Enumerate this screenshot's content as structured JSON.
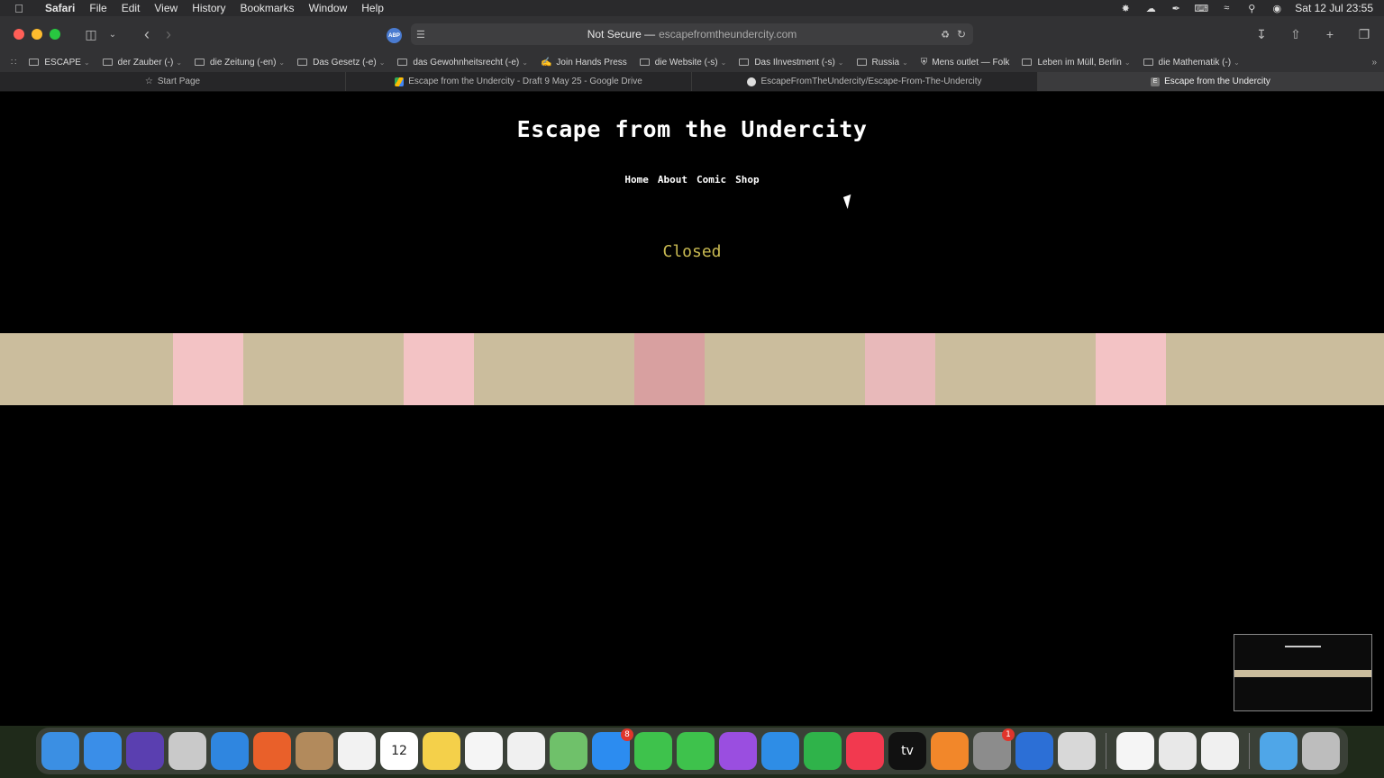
{
  "menubar": {
    "app_name": "Safari",
    "items": [
      "File",
      "Edit",
      "View",
      "History",
      "Bookmarks",
      "Window",
      "Help"
    ],
    "clock": "Sat 12 Jul  23:55",
    "status_icons": [
      "chatgpt-icon",
      "cloud-icon",
      "pen-icon",
      "keyboard-icon",
      "wifi-icon",
      "spotlight-icon",
      "control-center-icon"
    ]
  },
  "toolbar": {
    "security_label": "Not Secure —",
    "url": "escapefromtheundercity.com",
    "extension_badge": "ABP"
  },
  "bookmarks": [
    {
      "label": "ESCAPE",
      "type": "folder"
    },
    {
      "label": "der Zauber (-)",
      "type": "folder"
    },
    {
      "label": "die Zeitung (-en)",
      "type": "folder"
    },
    {
      "label": "Das Gesetz (-e)",
      "type": "folder"
    },
    {
      "label": "das Gewohnheitsrecht (-e)",
      "type": "folder"
    },
    {
      "label": "Join Hands Press",
      "type": "link"
    },
    {
      "label": "die Website (-s)",
      "type": "folder"
    },
    {
      "label": "Das Ilnvestment (-s)",
      "type": "folder"
    },
    {
      "label": "Russia",
      "type": "folder"
    },
    {
      "label": "Mens outlet — Folk",
      "type": "link"
    },
    {
      "label": "Leben im Müll, Berlin",
      "type": "folder"
    },
    {
      "label": "die Mathematik (-)",
      "type": "folder"
    }
  ],
  "tabs": [
    {
      "label": "Start Page",
      "active": false
    },
    {
      "label": "Escape from the Undercity - Draft 9 May 25 - Google Drive",
      "active": false
    },
    {
      "label": "EscapeFromTheUndercity/Escape-From-The-Undercity",
      "active": false
    },
    {
      "label": "Escape from the Undercity",
      "active": true
    }
  ],
  "site": {
    "title": "Escape from the Undercity",
    "nav": [
      "Home",
      "About",
      "Comic",
      "Shop"
    ],
    "status": "Closed",
    "strip_colors": {
      "base": "#cbbd9d",
      "pink_light": "#f3c3c5",
      "pink_dark": "#d8a0a0",
      "pink_mid": "#e8b9ba"
    }
  },
  "dock": {
    "apps": [
      {
        "name": "Finder",
        "icon": "finder-icon",
        "color": "#3b8fe3"
      },
      {
        "name": "Mail",
        "icon": "mail-icon",
        "color": "#3a8ee8"
      },
      {
        "name": "Siri",
        "icon": "siri-icon",
        "color": "#5a3fb0"
      },
      {
        "name": "Launchpad",
        "icon": "launchpad-icon",
        "color": "#c9c9c9"
      },
      {
        "name": "Safari",
        "icon": "safari-icon",
        "color": "#2f86e0"
      },
      {
        "name": "Firefox",
        "icon": "firefox-icon",
        "color": "#e9602a"
      },
      {
        "name": "Contacts",
        "icon": "contacts-icon",
        "color": "#b28a5c"
      },
      {
        "name": "Reminders",
        "icon": "reminders-icon",
        "color": "#f2f2f2"
      },
      {
        "name": "Calendar",
        "icon": "calendar-icon",
        "color": "#ffffff",
        "text": "12"
      },
      {
        "name": "Notes",
        "icon": "notes-icon",
        "color": "#f4d04a"
      },
      {
        "name": "Freeform",
        "icon": "freeform-icon",
        "color": "#f5f5f5"
      },
      {
        "name": "Photos",
        "icon": "photos-icon",
        "color": "#f0f0f0"
      },
      {
        "name": "Maps",
        "icon": "maps-icon",
        "color": "#6fc16a"
      },
      {
        "name": "App Store",
        "icon": "app-store-icon",
        "color": "#2c8cf0",
        "badge": "8"
      },
      {
        "name": "FaceTime",
        "icon": "facetime-icon",
        "color": "#3ec24c"
      },
      {
        "name": "Messages",
        "icon": "messages-icon",
        "color": "#3ec24c"
      },
      {
        "name": "Podcasts",
        "icon": "podcasts-icon",
        "color": "#9a4ee0"
      },
      {
        "name": "Keynote",
        "icon": "keynote-icon",
        "color": "#2e8de6"
      },
      {
        "name": "Numbers",
        "icon": "numbers-icon",
        "color": "#2fb34a"
      },
      {
        "name": "Music",
        "icon": "music-icon",
        "color": "#f2394f"
      },
      {
        "name": "TV",
        "icon": "tv-icon",
        "color": "#111111",
        "text": "tv"
      },
      {
        "name": "Books",
        "icon": "books-icon",
        "color": "#f2872a"
      },
      {
        "name": "System Settings",
        "icon": "settings-icon",
        "color": "#8c8c8c",
        "badge": "1"
      },
      {
        "name": "Ukraine App",
        "icon": "ukraine-icon",
        "color": "#2c6fd6"
      },
      {
        "name": "Pages",
        "icon": "pages-icon",
        "color": "#d8d8d8"
      }
    ],
    "recent_apps": [
      {
        "name": "ChatGPT",
        "icon": "chatgpt-icon",
        "color": "#f5f5f5"
      },
      {
        "name": "Chrome",
        "icon": "chrome-icon",
        "color": "#e8e8e8"
      },
      {
        "name": "TextEdit",
        "icon": "textedit-icon",
        "color": "#f0f0f0"
      }
    ],
    "utilities": [
      {
        "name": "Downloads",
        "icon": "folder-icon",
        "color": "#4fa6e8"
      },
      {
        "name": "Trash",
        "icon": "trash-icon",
        "color": "#bdbdbd"
      }
    ]
  }
}
